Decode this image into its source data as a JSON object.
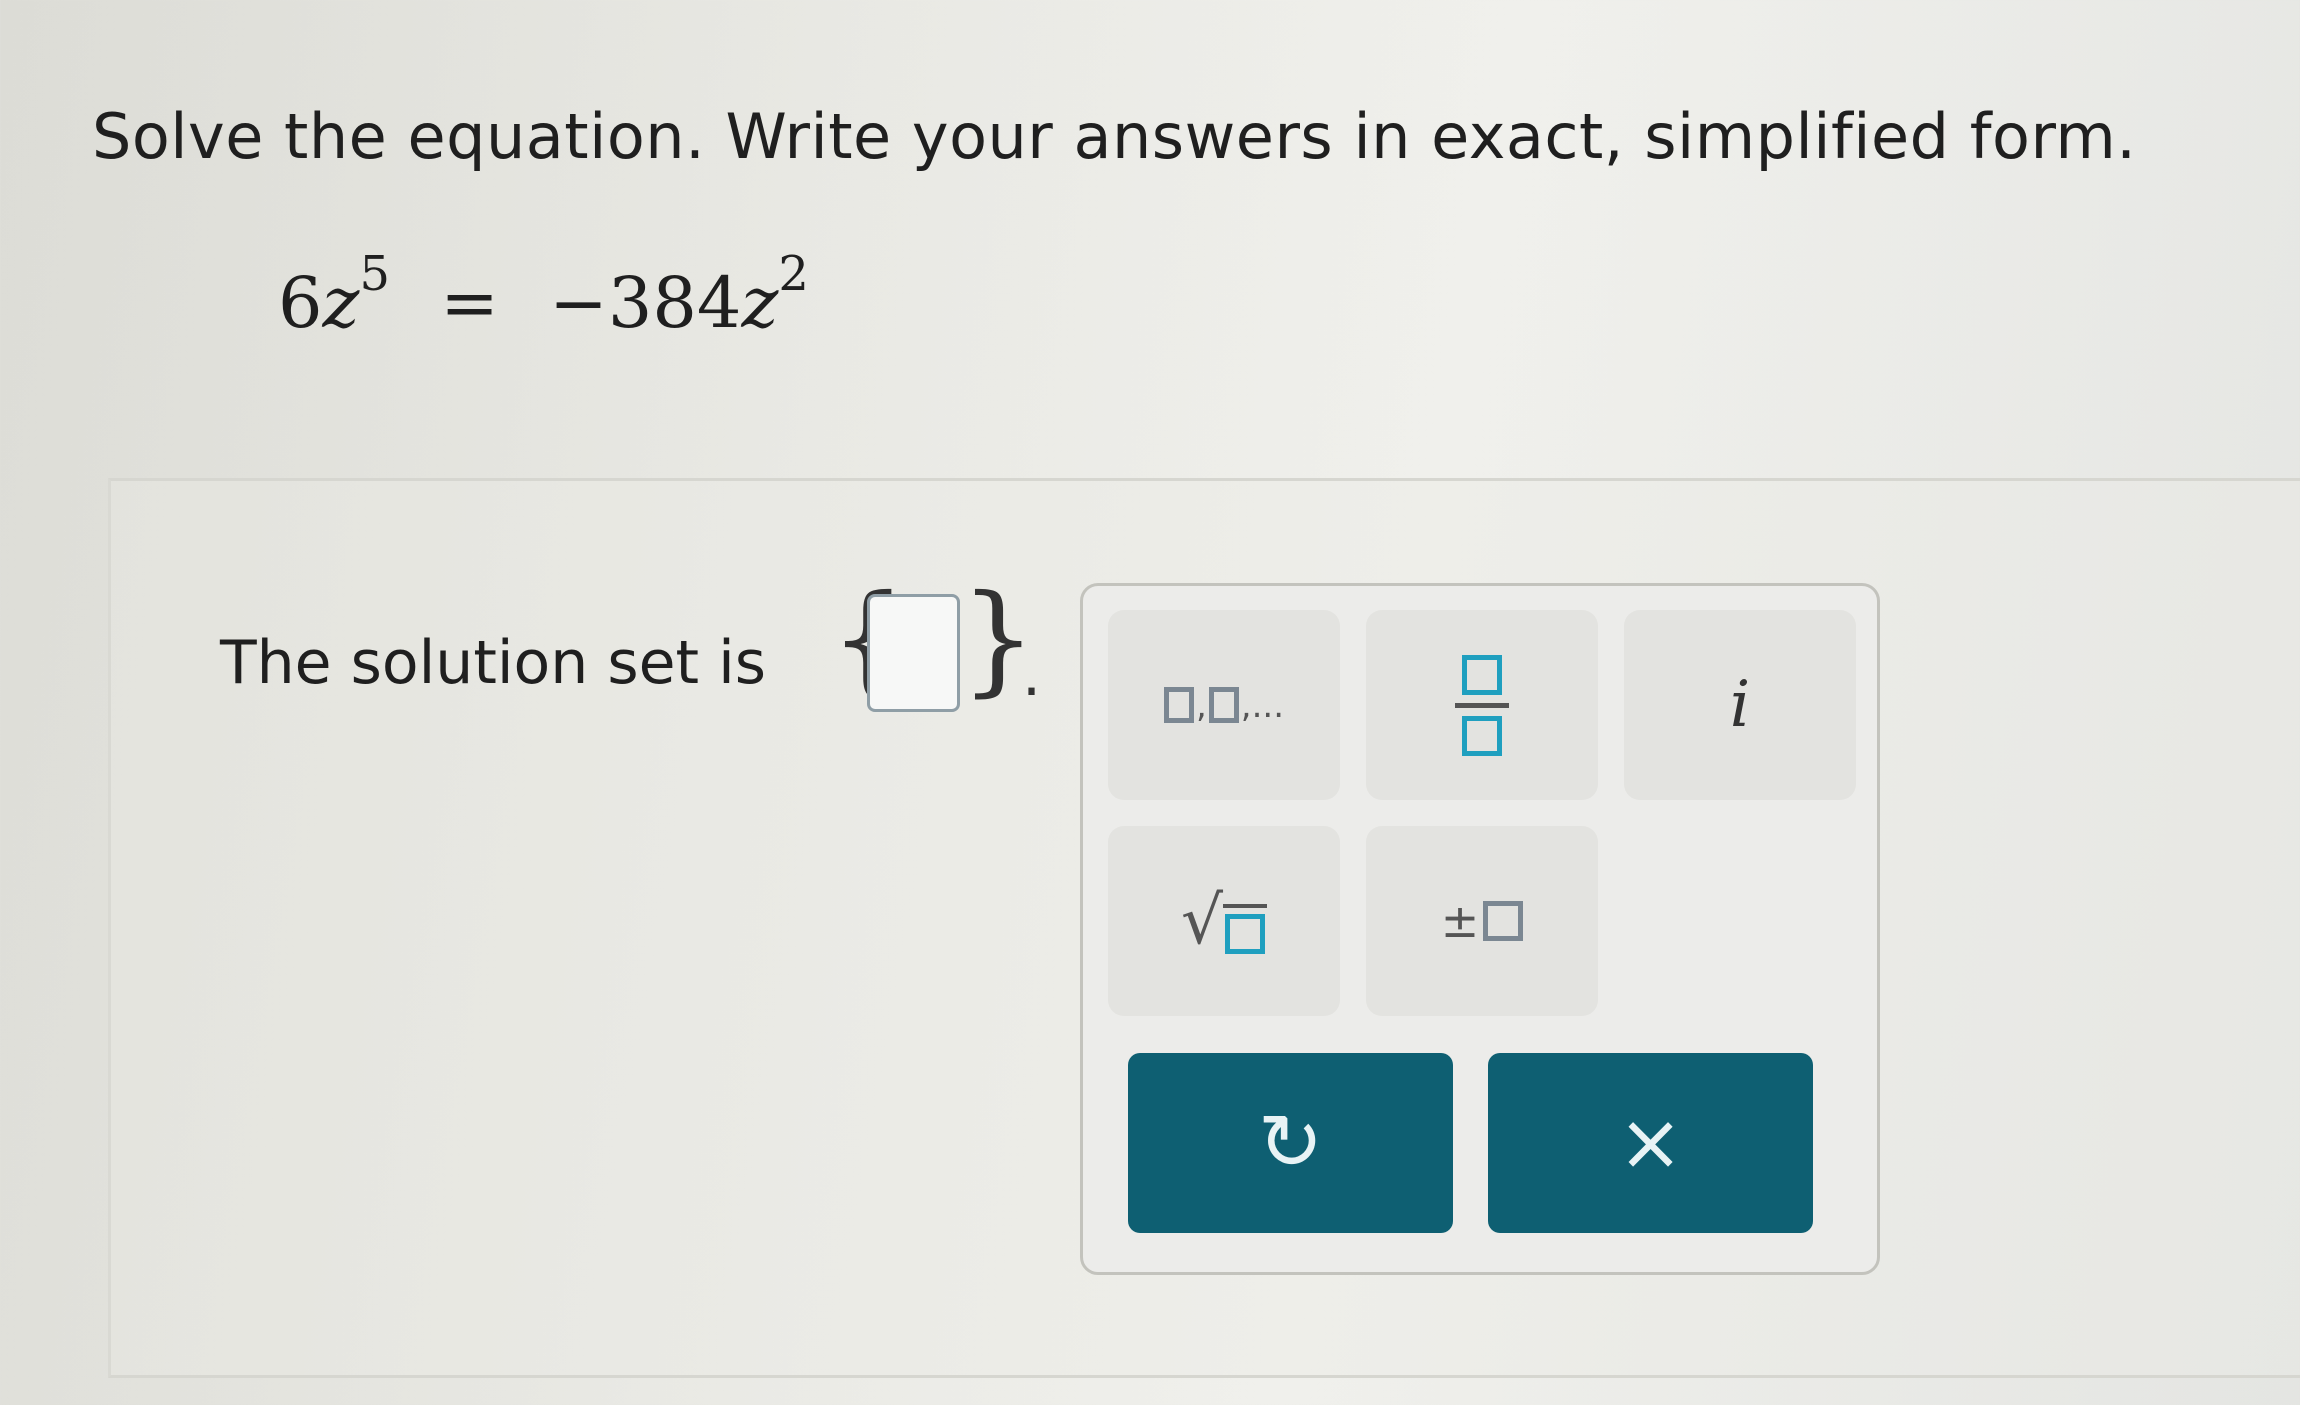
{
  "instruction": "Solve the equation. Write your answers in exact, simplified form.",
  "equation": {
    "left_coefficient": "6",
    "left_variable": "z",
    "left_exponent": "5",
    "equals": "=",
    "right_coefficient": "−384",
    "right_variable": "z",
    "right_exponent": "2"
  },
  "answer": {
    "prompt": "The solution set is",
    "brace_open": "{",
    "brace_close": "}",
    "value": "",
    "terminator": "."
  },
  "keypad": {
    "keys": [
      {
        "name": "list",
        "label_suffix": ",..."
      },
      {
        "name": "fraction"
      },
      {
        "name": "imaginary",
        "label": "i"
      },
      {
        "name": "square-root",
        "radical": "√"
      },
      {
        "name": "plus-minus",
        "label": "±"
      }
    ],
    "undo_glyph": "↻",
    "clear_glyph": "×"
  },
  "colors": {
    "accent_teal": "#1f9fbf",
    "action_button": "#0e5f72",
    "text": "#1f1f1f"
  },
  "icons": [
    "undo-icon",
    "clear-icon"
  ]
}
